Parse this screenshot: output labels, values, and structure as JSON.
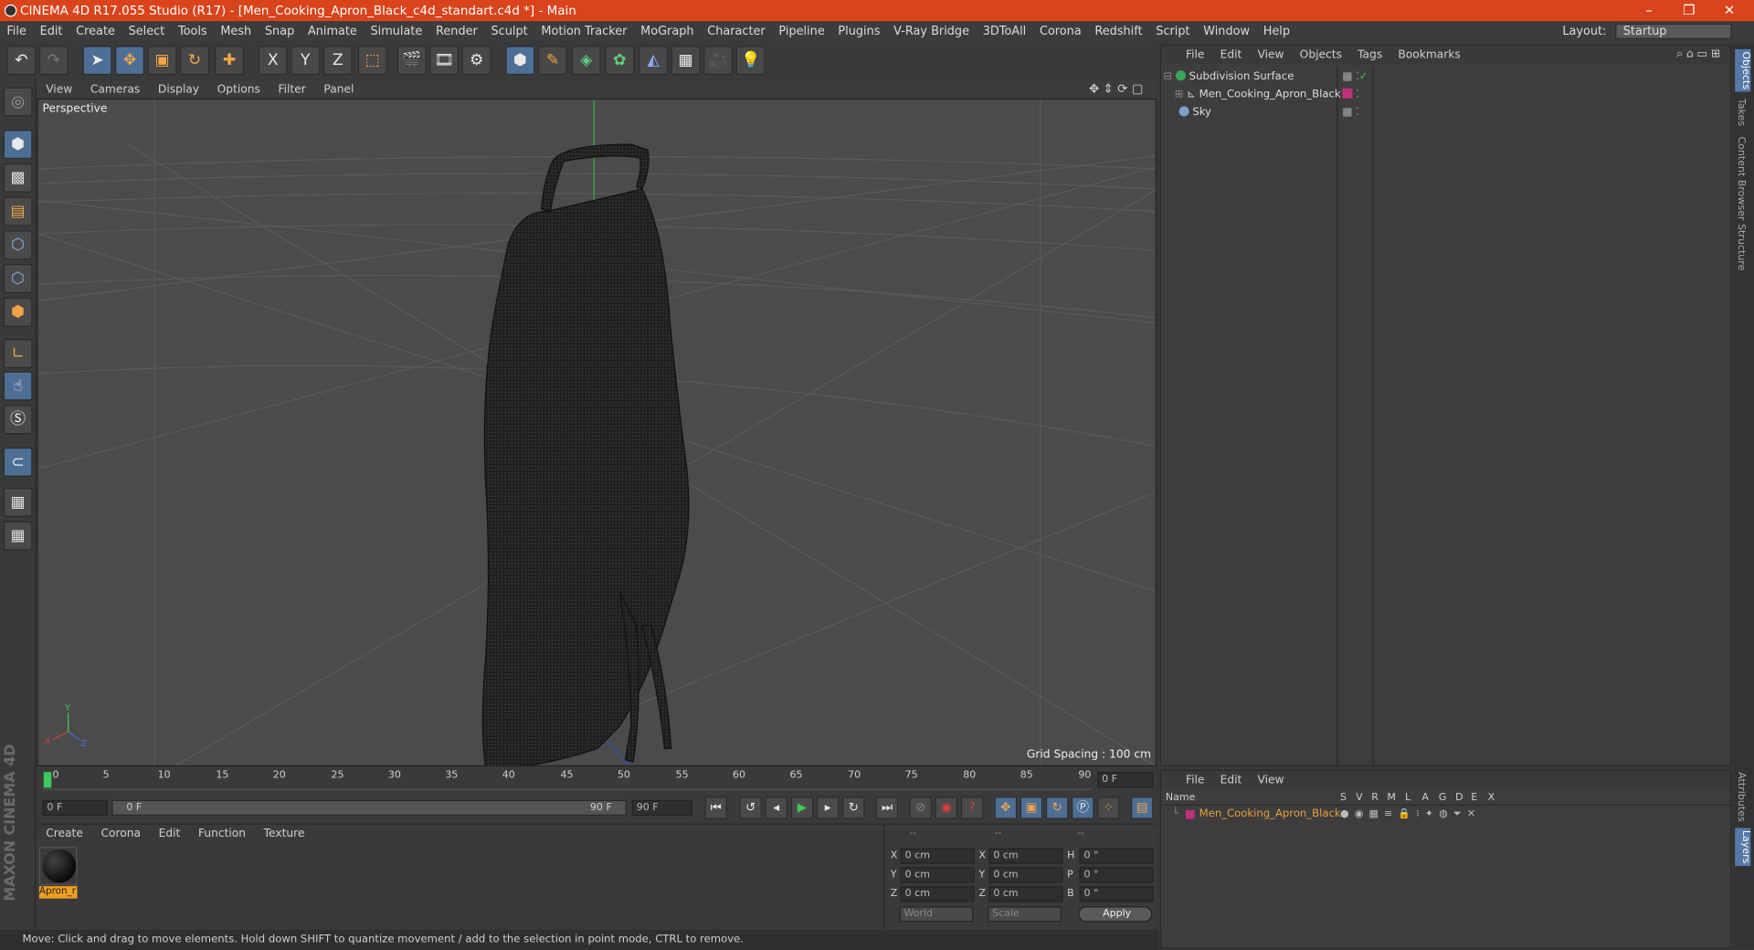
{
  "window": {
    "title": "CINEMA 4D R17.055 Studio (R17) - [Men_Cooking_Apron_Black_c4d_standart.c4d *] - Main",
    "min": "–",
    "restore": "❐",
    "close": "✕"
  },
  "menu": {
    "items": [
      "File",
      "Edit",
      "Create",
      "Select",
      "Tools",
      "Mesh",
      "Snap",
      "Animate",
      "Simulate",
      "Render",
      "Sculpt",
      "Motion Tracker",
      "MoGraph",
      "Character",
      "Pipeline",
      "Plugins",
      "V-Ray Bridge",
      "3DToAll",
      "Corona",
      "Redshift",
      "Script",
      "Window",
      "Help"
    ],
    "layout_label": "Layout:",
    "layout_value": "Startup"
  },
  "toolbar": {
    "icons": [
      "undo-icon",
      "redo-icon",
      "select-arrow-icon",
      "move-icon",
      "scale-icon",
      "rotate-icon",
      "add-icon",
      "x-axis-icon",
      "y-axis-icon",
      "z-axis-icon",
      "coordinate-system-icon",
      "render-view-icon",
      "render-picture-viewer-icon",
      "edit-render-settings-icon",
      "cube-icon",
      "pen-icon",
      "subdivision-icon",
      "cloner-icon",
      "deformer-icon",
      "floor-icon",
      "camera-icon",
      "light-icon"
    ],
    "axis_x": "X",
    "axis_y": "Y",
    "axis_z": "Z"
  },
  "viewport": {
    "menu": [
      "View",
      "Cameras",
      "Display",
      "Options",
      "Filter",
      "Panel"
    ],
    "label": "Perspective",
    "grid_spacing": "Grid Spacing : 100 cm"
  },
  "timeline": {
    "ticks": [
      "0",
      "5",
      "10",
      "15",
      "20",
      "25",
      "30",
      "35",
      "40",
      "45",
      "50",
      "55",
      "60",
      "65",
      "70",
      "75",
      "80",
      "85",
      "90"
    ],
    "current_frame": "0 F",
    "start_frame": "0 F",
    "range_start": "0 F",
    "range_end": "90 F",
    "end_frame": "90 F"
  },
  "material": {
    "menu": [
      "Create",
      "Corona",
      "Edit",
      "Function",
      "Texture"
    ],
    "name": "Apron_r"
  },
  "coords": {
    "header": [
      "--",
      "--",
      "--"
    ],
    "rows": [
      {
        "a": "X",
        "av": "0 cm",
        "b": "X",
        "bv": "0 cm",
        "c": "H",
        "cv": "0 °"
      },
      {
        "a": "Y",
        "av": "0 cm",
        "b": "Y",
        "bv": "0 cm",
        "c": "P",
        "cv": "0 °"
      },
      {
        "a": "Z",
        "av": "0 cm",
        "b": "Z",
        "bv": "0 cm",
        "c": "B",
        "cv": "0 °"
      }
    ],
    "world": "World",
    "scale": "Scale",
    "apply": "Apply"
  },
  "status": "Move: Click and drag to move elements. Hold down SHIFT to quantize movement / add to the selection in point mode, CTRL to remove.",
  "objects": {
    "menu": [
      "File",
      "Edit",
      "View",
      "Objects",
      "Tags",
      "Bookmarks"
    ],
    "items": [
      {
        "name": "Subdivision Surface",
        "color": "#3aa65a"
      },
      {
        "name": "Men_Cooking_Apron_Black",
        "color": "#c0c0c0"
      },
      {
        "name": "Sky",
        "color": "#7aa0d0"
      }
    ]
  },
  "layers": {
    "menu": [
      "File",
      "Edit",
      "View"
    ],
    "headers": [
      "Name",
      "S",
      "V",
      "R",
      "M",
      "L",
      "A",
      "G",
      "D",
      "E",
      "X"
    ],
    "row": "Men_Cooking_Apron_Black",
    "row_color": "#e7a13a",
    "swatch": "#c0307a"
  },
  "side_tabs": [
    "Objects",
    "Takes",
    "Content Browser",
    "Structure",
    "Attributes",
    "Layers"
  ],
  "brand": "MAXON CINEMA 4D"
}
